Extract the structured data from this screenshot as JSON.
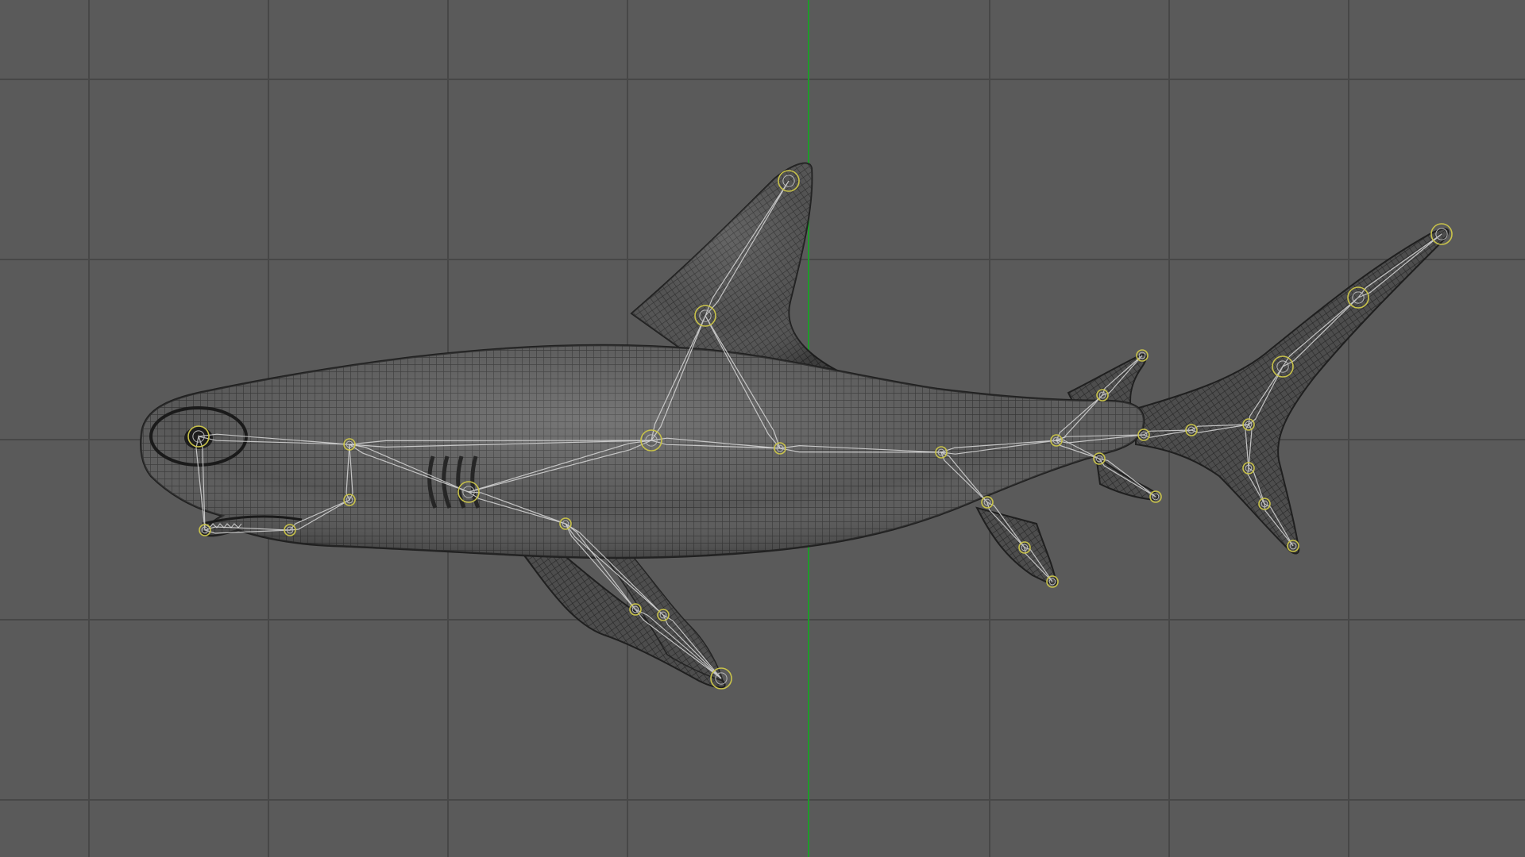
{
  "viewport": {
    "view": "side",
    "background_color": "#5a5a5a",
    "grid_color": "#474747",
    "grid_visible": true,
    "vertical_axis_color": "#1f9a2a",
    "horizontal_axis_color": "#c23a3a"
  },
  "model": {
    "kind": "shark",
    "display": "wireframe",
    "surface_color": "#4f4f4f",
    "wire_color": "#2a2a2a",
    "rig_bone_color": "#d8d8d8",
    "joint_color": "#c8c24a"
  }
}
